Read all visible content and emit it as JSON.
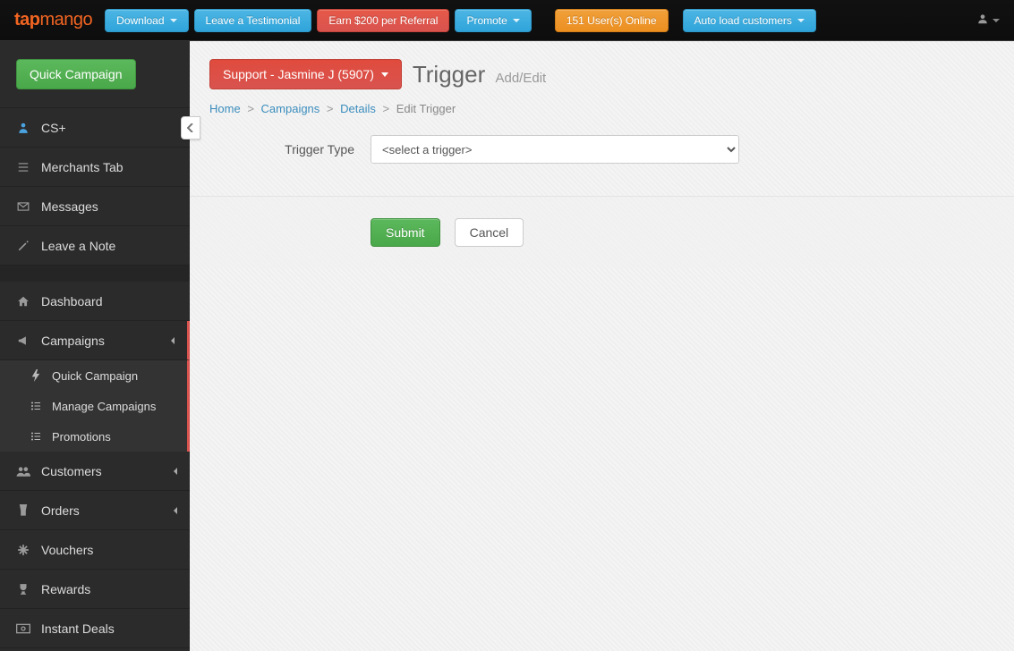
{
  "brand": {
    "prefix": "tap",
    "suffix": "mango"
  },
  "topbar": {
    "download": "Download",
    "testimonial": "Leave a Testimonial",
    "referral": "Earn $200 per Referral",
    "promote": "Promote",
    "users_online": "151 User(s) Online",
    "autoload": "Auto load customers"
  },
  "sidebar": {
    "quick_campaign_button": "Quick Campaign",
    "items": {
      "cs_plus": "CS+",
      "merchants_tab": "Merchants Tab",
      "messages": "Messages",
      "leave_note": "Leave a Note",
      "dashboard": "Dashboard",
      "campaigns": "Campaigns",
      "customers": "Customers",
      "orders": "Orders",
      "vouchers": "Vouchers",
      "rewards": "Rewards",
      "instant_deals": "Instant Deals"
    },
    "campaigns_sub": {
      "quick": "Quick Campaign",
      "manage": "Manage Campaigns",
      "promotions": "Promotions"
    }
  },
  "main": {
    "merchant_selector": "Support - Jasmine J (5907)",
    "title": "Trigger",
    "subtitle": "Add/Edit",
    "breadcrumbs": {
      "home": "Home",
      "campaigns": "Campaigns",
      "details": "Details",
      "current": "Edit Trigger"
    },
    "form": {
      "trigger_type_label": "Trigger Type",
      "trigger_type_placeholder": "<select a trigger>",
      "submit": "Submit",
      "cancel": "Cancel"
    }
  }
}
